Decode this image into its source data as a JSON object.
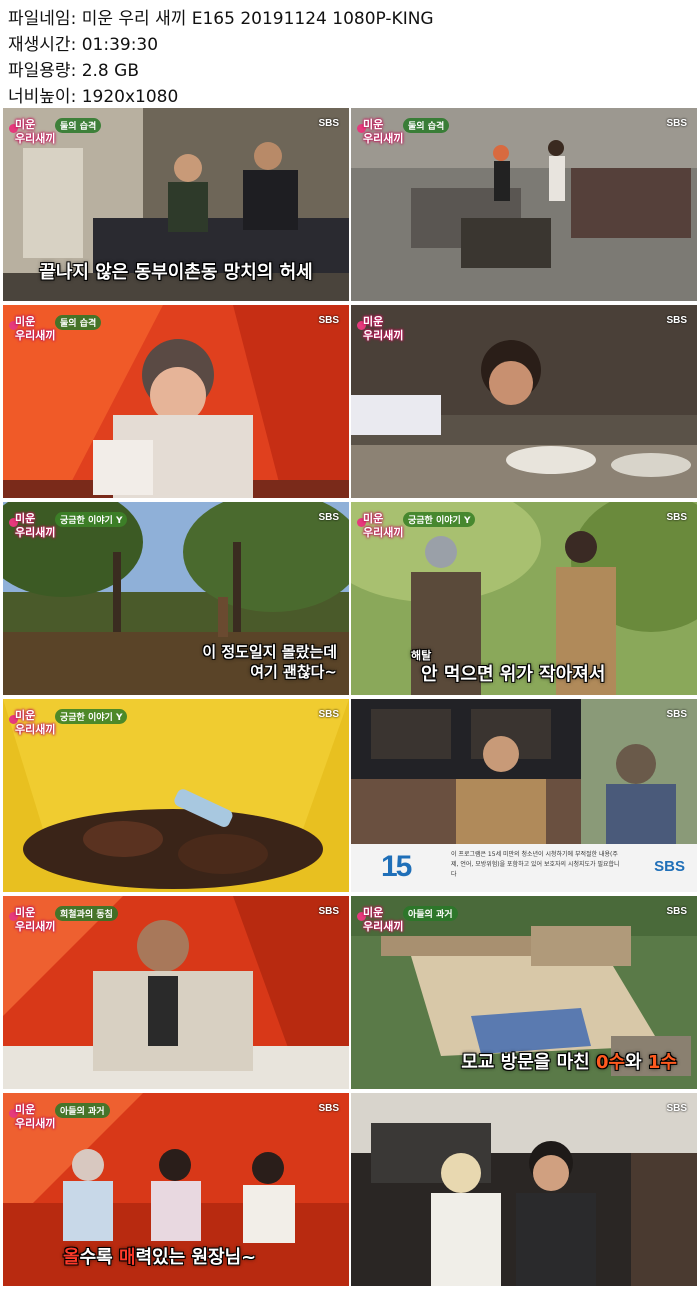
{
  "meta": [
    {
      "key": "파일네임",
      "value": "미운 우리 새끼 E165 20191124 1080P-KING"
    },
    {
      "key": "재생시간",
      "value": "01:39:30"
    },
    {
      "key": "파일용량",
      "value": "2.8 GB"
    },
    {
      "key": "너비높이",
      "value": "1920x1080"
    }
  ],
  "logo": {
    "line1": "미운",
    "line2": "우리새끼"
  },
  "network": "SBS",
  "thumbnails": [
    {
      "tag": "둘의 습격",
      "subtitle": "끝나지 않은 동부이촌동 망치의 허세"
    },
    {
      "tag": "둘의 습격"
    },
    {
      "tag": "둘의 습격"
    },
    {},
    {
      "tag": "궁금한 이야기 Y",
      "subtitle_lines": [
        "이 정도일지 몰랐는데",
        "여기 괜찮다~"
      ]
    },
    {
      "tag": "궁금한 이야기 Y",
      "subtitle_small": "해탈",
      "subtitle": "안 먹으면 위가 작아져서"
    },
    {
      "tag": "궁금한 이야기 Y"
    },
    {
      "notice": {
        "age": "15",
        "message": "이 프로그램은 15세 미만의 청소년이 시청하기에 부적절한 내용(주제, 언어, 모방위험)을 포함하고 있어 보호자의 시청지도가 필요합니다",
        "network": "SBS"
      }
    },
    {
      "tag": "희철과의 동침"
    },
    {
      "tag": "아들의 과거",
      "subtitle_parts": [
        "모교 방문을 마친 ",
        "0수",
        "와 ",
        "1수"
      ]
    },
    {
      "tag": "아들의 과거",
      "subtitle_parts": [
        "올",
        "수록 ",
        "매",
        "력있는 원장님~"
      ]
    },
    {}
  ]
}
